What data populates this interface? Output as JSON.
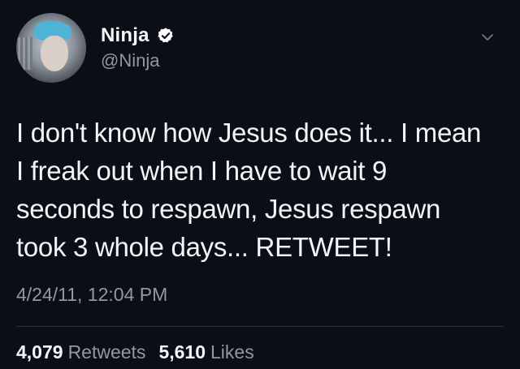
{
  "user": {
    "name": "Ninja",
    "handle": "@Ninja",
    "verified": true
  },
  "icons": {
    "verified": "verified-badge-icon",
    "menu": "chevron-down-icon"
  },
  "tweet": {
    "lines": [
      "I don't know how Jesus does it... I mean",
      "I freak out when I have to wait 9",
      "seconds to respawn, Jesus respawn",
      "took 3 whole days... RETWEET!"
    ],
    "timestamp": "4/24/11, 12:04 PM"
  },
  "stats": {
    "retweets_count": "4,079",
    "retweets_label": "Retweets",
    "likes_count": "5,610",
    "likes_label": "Likes"
  },
  "colors": {
    "background": "#0b0e16",
    "text_primary": "#f3f4f6",
    "text_secondary": "#8d99a6",
    "divider": "#2a323c",
    "verified_badge": "#ffffff"
  }
}
